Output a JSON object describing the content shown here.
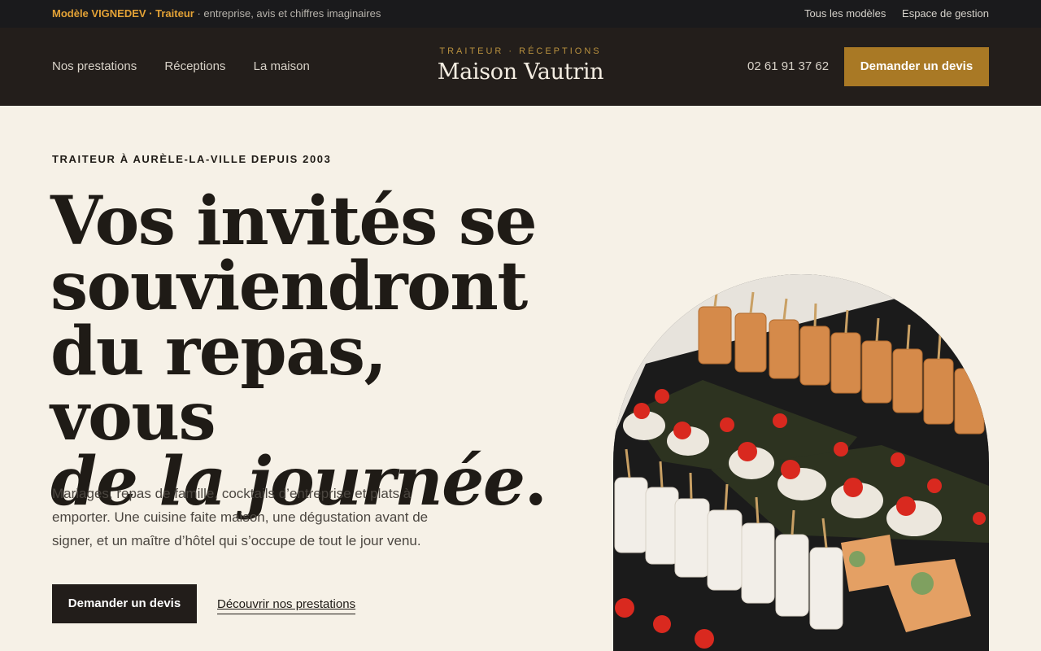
{
  "topbar": {
    "brand": "Modèle VIGNEDEV · Traiteur",
    "tagline": " · entreprise, avis et chiffres imaginaires",
    "links": [
      "Tous les modèles",
      "Espace de gestion"
    ]
  },
  "header": {
    "nav": [
      "Nos prestations",
      "Réceptions",
      "La maison"
    ],
    "logo_kicker": "TRAITEUR · RÉCEPTIONS",
    "logo_name": "Maison Vautrin",
    "phone": "02 61 91 37 62",
    "cta": "Demander un devis"
  },
  "hero": {
    "eyebrow": "TRAITEUR À AURÈLE-LA-VILLE DEPUIS 2003",
    "headline_main": "Vos invités se souviendront du repas, vous",
    "headline_italic": "de la journée",
    "headline_end": ".",
    "lead": "Mariages, repas de famille, cocktails d’entreprise et plats à emporter. Une cuisine faite maison, une dégustation avant de signer, et un maître d’hôtel qui s’occupe de tout le jour venu.",
    "primary_button": "Demander un devis",
    "secondary_link": "Découvrir nos prestations"
  },
  "colors": {
    "accent": "#a97925",
    "dark": "#231e1b",
    "background": "#f6f1e7"
  }
}
